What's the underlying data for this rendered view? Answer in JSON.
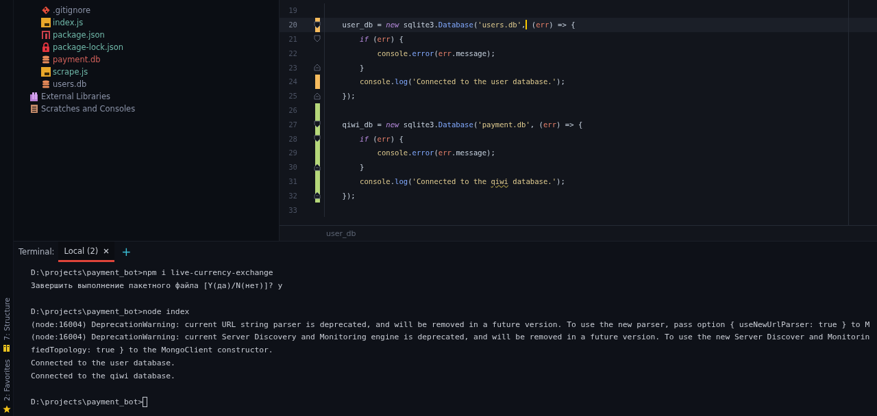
{
  "tool_strip": [
    {
      "label": "7: Structure",
      "kind": "structure"
    },
    {
      "label": "2: Favorites",
      "kind": "star"
    }
  ],
  "project_tree": {
    "items": [
      {
        "label": ".gitignore",
        "kind": "git",
        "color": "#8b93a8"
      },
      {
        "label": "index.js",
        "kind": "js",
        "color": "#6fb7a8"
      },
      {
        "label": "package.json",
        "kind": "npm",
        "color": "#6fb7a8"
      },
      {
        "label": "package-lock.json",
        "kind": "lock",
        "color": "#6fb7a8"
      },
      {
        "label": "payment.db",
        "kind": "db",
        "color": "#d0605a"
      },
      {
        "label": "scrape.js",
        "kind": "js",
        "color": "#6fb7a8"
      },
      {
        "label": "users.db",
        "kind": "db",
        "color": "#8b93a8"
      }
    ],
    "roots": [
      {
        "label": "External Libraries",
        "kind": "library"
      },
      {
        "label": "Scratches and Consoles",
        "kind": "scratches"
      }
    ]
  },
  "editor": {
    "lines": [
      {
        "number": "19",
        "modified": false,
        "added": false,
        "fold_start": false,
        "fold_end": false,
        "current": false
      },
      {
        "number": "20",
        "modified": true,
        "added": false,
        "fold_start": true,
        "fold_end": false,
        "current": true,
        "tokens": [
          {
            "kind": "plain",
            "text": "    user_db = "
          },
          {
            "kind": "keyword",
            "text": "new"
          },
          {
            "kind": "plain",
            "text": " sqlite3."
          },
          {
            "kind": "func",
            "text": "Database"
          },
          {
            "kind": "plain",
            "text": "("
          },
          {
            "kind": "string",
            "text": "'users.db'"
          },
          {
            "kind": "plain",
            "text": ","
          },
          {
            "kind": "caret"
          },
          {
            "kind": "plain",
            "text": " ("
          },
          {
            "kind": "param",
            "text": "err"
          },
          {
            "kind": "plain",
            "text": ") => {"
          }
        ]
      },
      {
        "number": "21",
        "modified": false,
        "added": false,
        "fold_start": true,
        "fold_end": false,
        "current": false,
        "tokens": [
          {
            "kind": "keyword",
            "text": "        if"
          },
          {
            "kind": "plain",
            "text": " ("
          },
          {
            "kind": "param",
            "text": "err"
          },
          {
            "kind": "plain",
            "text": ") {"
          }
        ]
      },
      {
        "number": "22",
        "modified": false,
        "added": false,
        "fold_start": false,
        "fold_end": false,
        "current": false,
        "tokens": [
          {
            "kind": "object",
            "text": "            console"
          },
          {
            "kind": "plain",
            "text": "."
          },
          {
            "kind": "func",
            "text": "error"
          },
          {
            "kind": "plain",
            "text": "("
          },
          {
            "kind": "param",
            "text": "err"
          },
          {
            "kind": "plain",
            "text": ".message);"
          }
        ]
      },
      {
        "number": "23",
        "modified": false,
        "added": false,
        "fold_start": false,
        "fold_end": true,
        "current": false,
        "tokens": [
          {
            "kind": "plain",
            "text": "        }"
          }
        ]
      },
      {
        "number": "24",
        "modified": true,
        "added": false,
        "fold_start": false,
        "fold_end": false,
        "current": false,
        "tokens": [
          {
            "kind": "object",
            "text": "        console"
          },
          {
            "kind": "plain",
            "text": "."
          },
          {
            "kind": "func",
            "text": "log"
          },
          {
            "kind": "plain",
            "text": "("
          },
          {
            "kind": "string",
            "text": "'Connected to the user database.'"
          },
          {
            "kind": "plain",
            "text": ");"
          }
        ]
      },
      {
        "number": "25",
        "modified": false,
        "added": false,
        "fold_start": false,
        "fold_end": true,
        "current": false,
        "tokens": [
          {
            "kind": "plain",
            "text": "    });"
          }
        ]
      },
      {
        "number": "26",
        "modified": false,
        "added": true,
        "fold_start": false,
        "fold_end": false,
        "current": false
      },
      {
        "number": "27",
        "modified": false,
        "added": true,
        "fold_start": true,
        "fold_end": false,
        "current": false,
        "tokens": [
          {
            "kind": "plain",
            "text": "    qiwi_db = "
          },
          {
            "kind": "keyword",
            "text": "new"
          },
          {
            "kind": "plain",
            "text": " sqlite3."
          },
          {
            "kind": "func",
            "text": "Database"
          },
          {
            "kind": "plain",
            "text": "("
          },
          {
            "kind": "string",
            "text": "'payment.db'"
          },
          {
            "kind": "plain",
            "text": ", ("
          },
          {
            "kind": "param",
            "text": "err"
          },
          {
            "kind": "plain",
            "text": ") => {"
          }
        ]
      },
      {
        "number": "28",
        "modified": false,
        "added": true,
        "fold_start": true,
        "fold_end": false,
        "current": false,
        "tokens": [
          {
            "kind": "keyword",
            "text": "        if"
          },
          {
            "kind": "plain",
            "text": " ("
          },
          {
            "kind": "param",
            "text": "err"
          },
          {
            "kind": "plain",
            "text": ") {"
          }
        ]
      },
      {
        "number": "29",
        "modified": false,
        "added": true,
        "fold_start": false,
        "fold_end": false,
        "current": false,
        "tokens": [
          {
            "kind": "object",
            "text": "            console"
          },
          {
            "kind": "plain",
            "text": "."
          },
          {
            "kind": "func",
            "text": "error"
          },
          {
            "kind": "plain",
            "text": "("
          },
          {
            "kind": "param",
            "text": "err"
          },
          {
            "kind": "plain",
            "text": ".message);"
          }
        ]
      },
      {
        "number": "30",
        "modified": false,
        "added": true,
        "fold_start": false,
        "fold_end": true,
        "current": false,
        "tokens": [
          {
            "kind": "plain",
            "text": "        }"
          }
        ]
      },
      {
        "number": "31",
        "modified": false,
        "added": true,
        "fold_start": false,
        "fold_end": false,
        "current": false,
        "tokens": [
          {
            "kind": "object",
            "text": "        console"
          },
          {
            "kind": "plain",
            "text": "."
          },
          {
            "kind": "func",
            "text": "log"
          },
          {
            "kind": "plain",
            "text": "("
          },
          {
            "kind": "string",
            "text": "'Connected to the "
          },
          {
            "kind": "typo",
            "text": "qiwi"
          },
          {
            "kind": "string",
            "text": " database.'"
          },
          {
            "kind": "plain",
            "text": ");"
          }
        ]
      },
      {
        "number": "32",
        "modified": false,
        "added": true,
        "fold_start": false,
        "fold_end": true,
        "current": false,
        "tokens": [
          {
            "kind": "plain",
            "text": "    });"
          }
        ]
      },
      {
        "number": "33",
        "modified": false,
        "added": false,
        "fold_start": false,
        "fold_end": false,
        "current": false
      }
    ],
    "breadcrumb": "user_db"
  },
  "terminal": {
    "title": "Terminal:",
    "tabs": [
      {
        "label": "Local (2)",
        "selected": true
      }
    ],
    "new_tab": "+",
    "lines": [
      {
        "text": "D:\\projects\\payment_bot>npm i live-currency-exchange"
      },
      {
        "text": "Завершить выполнение пакетного файла [Y(да)/N(нет)]? y"
      },
      {
        "kind": "blank"
      },
      {
        "text": "D:\\projects\\payment_bot>node index"
      },
      {
        "text": "(node:16004) DeprecationWarning: current URL string parser is deprecated, and will be removed in a future version. To use the new parser, pass option { useNewUrlParser: true } to M"
      },
      {
        "text": "(node:16004) DeprecationWarning: current Server Discovery and Monitoring engine is deprecated, and will be removed in a future version. To use the new Server Discover and Monitorin"
      },
      {
        "text": "fiedTopology: true } to the MongoClient constructor."
      },
      {
        "text": "Connected to the user database."
      },
      {
        "text": "Connected to the qiwi database."
      },
      {
        "kind": "blank"
      }
    ],
    "prompt": "D:\\projects\\payment_bot>"
  }
}
